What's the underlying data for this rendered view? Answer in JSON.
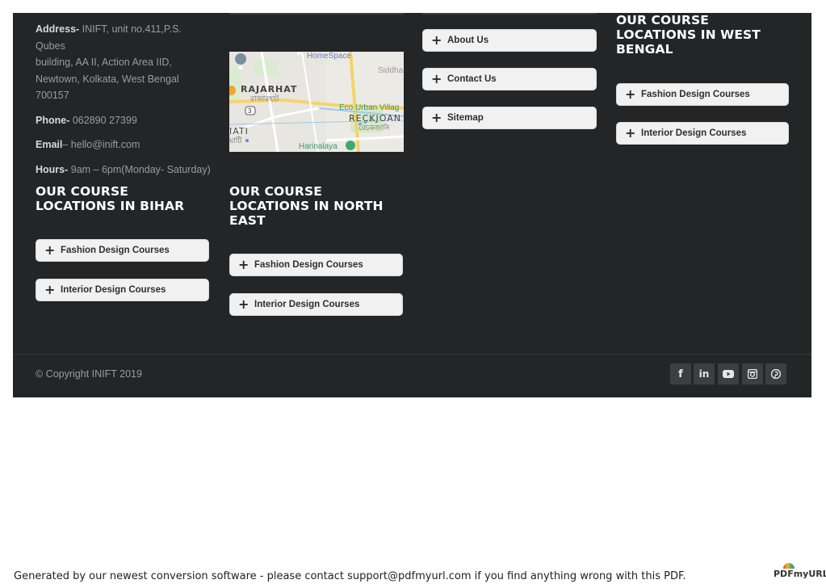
{
  "contact": {
    "address_label": "Address-",
    "address_lines": [
      "INIFT, unit no.411,P.S. Qubes",
      "building, AA II, Action Area IID,",
      "Newtown, Kolkata, West Bengal",
      "700157"
    ],
    "phone_label": "Phone-",
    "phone_value": "062890 27399",
    "email_label": "Email",
    "email_value": "– hello@inift.com",
    "hours_label": "Hours-",
    "hours_value": "9am – 6pm(Monday- Saturday)"
  },
  "map": {
    "labels": {
      "homespace": "HomeSpace",
      "siddha": "Siddha",
      "rajarhat": "RAJARHAT",
      "rajarhat_bn": "রাজারহাট",
      "road_no": "3",
      "eco_urban": "Eco Urban Villag",
      "reckjoan": "RECKJOAN",
      "reckjoan_bn": "রেচকজানি",
      "iati": "IATI",
      "iati_bn": "য়াটি",
      "harinalaya": "Harinalaya"
    }
  },
  "links": {
    "items": [
      "About Us",
      "Contact Us",
      "Sitemap"
    ]
  },
  "west_bengal": {
    "heading_lines": [
      "OUR COURSE",
      "LOCATIONS IN WEST",
      "BENGAL"
    ],
    "items": [
      "Fashion Design Courses",
      "Interior Design Courses"
    ]
  },
  "bihar": {
    "heading_lines": [
      "OUR COURSE",
      "LOCATIONS IN BIHAR"
    ],
    "items": [
      "Fashion Design Courses",
      "Interior Design Courses"
    ]
  },
  "north_east": {
    "heading_lines": [
      "OUR COURSE",
      "LOCATIONS IN NORTH",
      "EAST"
    ],
    "items": [
      "Fashion Design Courses",
      "Interior Design Courses"
    ]
  },
  "accordion_glyph": "+",
  "copyright": "© Copyright INIFT 2019",
  "social": {
    "facebook": "f",
    "linkedin": "in"
  },
  "pdf_note": "Generated by our newest conversion software - please contact support@pdfmyurl.com if you find anything wrong with this PDF.",
  "pdf_logo": "PDFmyURL",
  "colors": {
    "footer_bg": "#232527",
    "accordion_bg": "#f1f1f1",
    "heading": "#ffffff",
    "muted_text": "#9a9c9f"
  }
}
